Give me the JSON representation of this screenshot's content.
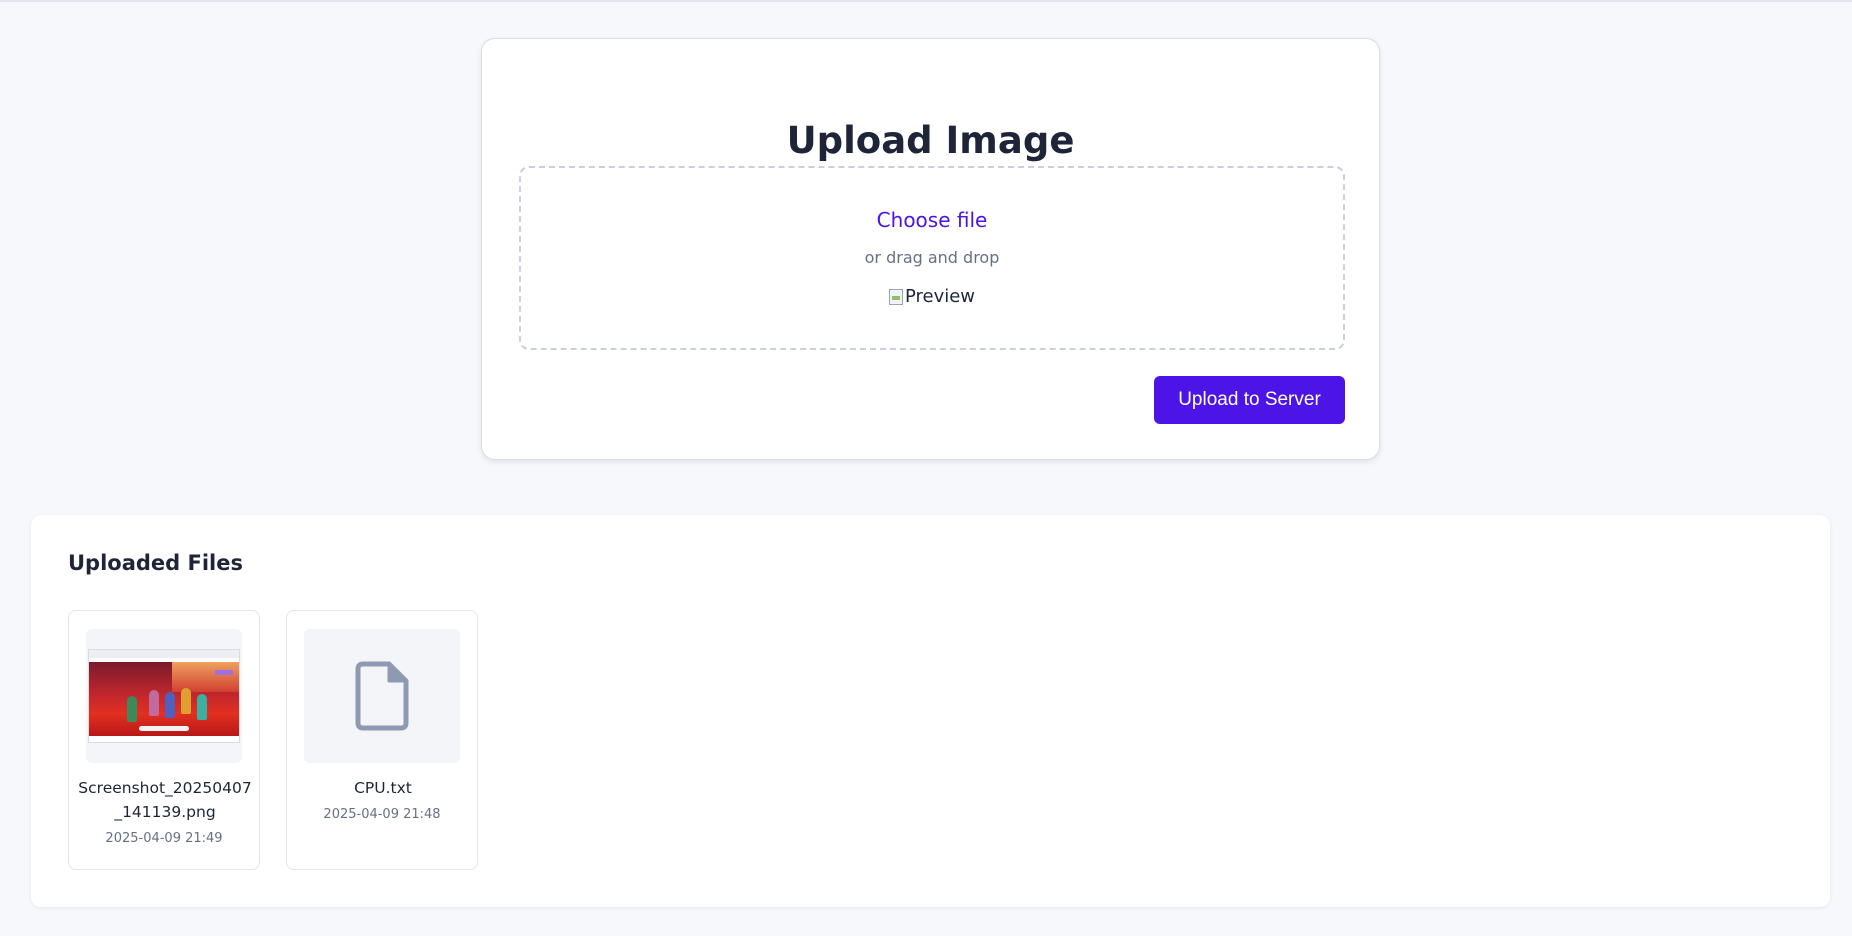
{
  "upload": {
    "title": "Upload Image",
    "choose_file_label": "Choose file",
    "drag_hint": "or drag and drop",
    "preview_alt": "Preview",
    "upload_button_label": "Upload to Server"
  },
  "files": {
    "title": "Uploaded Files",
    "items": [
      {
        "name": "Screenshot_20250407_141139.png",
        "date": "2025-04-09 21:49",
        "icon": "image-thumbnail"
      },
      {
        "name": "CPU.txt",
        "date": "2025-04-09 21:48",
        "icon": "document-icon"
      }
    ]
  },
  "colors": {
    "accent": "#4c14e6",
    "page_background": "#f7f8fb",
    "text_primary": "#1e2538",
    "text_muted": "#667085"
  }
}
